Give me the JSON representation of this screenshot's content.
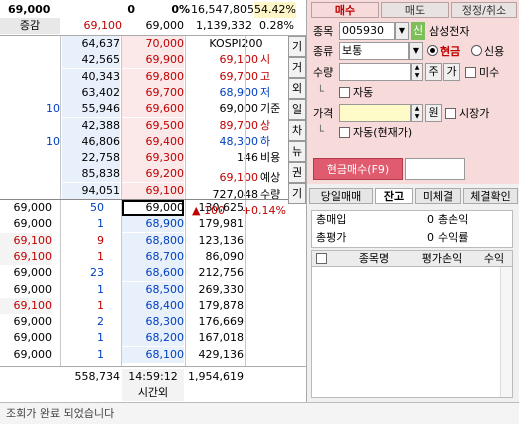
{
  "header": {
    "price": "69,000",
    "change": "0",
    "rate": "0%",
    "volume": "16,547,805",
    "vol_rate": "54.42%",
    "label": "증감",
    "prev_price": "69,100",
    "base_price": "69,000",
    "amount": "1,139,332",
    "amount_rate": "0.28%"
  },
  "orderbook": {
    "sell": [
      {
        "change": "",
        "qty": "64,637",
        "price": "70,000"
      },
      {
        "change": "",
        "qty": "42,565",
        "price": "69,900"
      },
      {
        "change": "",
        "qty": "40,343",
        "price": "69,800"
      },
      {
        "change": "",
        "qty": "63,402",
        "price": "69,700"
      },
      {
        "change": "10",
        "qty": "55,946",
        "price": "69,600"
      },
      {
        "change": "",
        "qty": "42,388",
        "price": "69,500"
      },
      {
        "change": "10",
        "qty": "46,806",
        "price": "69,400"
      },
      {
        "change": "",
        "qty": "22,758",
        "price": "69,300"
      },
      {
        "change": "",
        "qty": "85,838",
        "price": "69,200"
      },
      {
        "change": "",
        "qty": "94,051",
        "price": "69,100"
      }
    ],
    "buy": [
      {
        "price": "69,000",
        "qty": "130,625"
      },
      {
        "price": "68,900",
        "qty": "179,981"
      },
      {
        "price": "68,800",
        "qty": "123,136"
      },
      {
        "price": "68,700",
        "qty": "86,090"
      },
      {
        "price": "68,600",
        "qty": "212,756"
      },
      {
        "price": "68,500",
        "qty": "269,330"
      },
      {
        "price": "68,400",
        "qty": "179,878"
      },
      {
        "price": "68,300",
        "qty": "176,669"
      },
      {
        "price": "68,200",
        "qty": "167,018"
      },
      {
        "price": "68,100",
        "qty": "429,136"
      }
    ],
    "ticks": [
      {
        "price": "69,000",
        "qty": "50"
      },
      {
        "price": "69,000",
        "qty": "1"
      },
      {
        "price": "69,100",
        "qty": "9"
      },
      {
        "price": "69,100",
        "qty": "1"
      },
      {
        "price": "69,000",
        "qty": "23"
      },
      {
        "price": "69,000",
        "qty": "1"
      },
      {
        "price": "69,100",
        "qty": "1"
      },
      {
        "price": "69,000",
        "qty": "2"
      },
      {
        "price": "69,000",
        "qty": "1"
      },
      {
        "price": "69,000",
        "qty": "1"
      }
    ],
    "total_sell": "558,734",
    "time": "14:59:12",
    "time_label": "시간외",
    "total_buy": "1,954,619"
  },
  "info": {
    "index_name": "KOSPI200",
    "rows": [
      {
        "value": "69,100",
        "label": "시"
      },
      {
        "value": "69,700",
        "label": "고"
      },
      {
        "value": "68,900",
        "label": "저"
      },
      {
        "value": "69,000",
        "label": "기준"
      },
      {
        "value": "89,700",
        "label": "상"
      },
      {
        "value": "48,300",
        "label": "하"
      },
      {
        "value": "146",
        "label": "비용"
      }
    ],
    "expected_price": "69,100",
    "expected_label": "예상",
    "expected_qty": "727,048",
    "expected_qty_label": "수량",
    "expected_change": "▲ 100",
    "expected_rate": "+0.14%"
  },
  "side_buttons": [
    "기",
    "거",
    "외",
    "일",
    "차",
    "뉴",
    "권",
    "기"
  ],
  "order": {
    "tabs": [
      "매수",
      "매도",
      "정정/취소"
    ],
    "stock_label": "종목",
    "stock_code": "005930",
    "stock_tag": "신",
    "stock_name": "삼성전자",
    "type_label": "종류",
    "type_value": "보통",
    "cash_label": "현금",
    "credit_label": "신용",
    "qty_label": "수량",
    "qty_btn1": "주",
    "qty_btn2": "가",
    "miss_label": "미수",
    "auto_label": "자동",
    "price_label": "가격",
    "won_label": "원",
    "market_label": "시장가",
    "auto_cur_label": "자동(현재가)",
    "submit_label": "현금매수(F9)"
  },
  "balance": {
    "tabs": [
      "당일매매",
      "잔고",
      "미체결",
      "체결확인"
    ],
    "total_buy_label": "총매입",
    "total_buy_value": "0",
    "profit_label": "총손익",
    "total_eval_label": "총평가",
    "total_eval_value": "0",
    "yield_label": "수익률",
    "columns": [
      "종목명",
      "평가손익",
      "수익"
    ]
  },
  "status": {
    "message": "조회가 완료 되었습니다"
  },
  "colors": {
    "accent_red": "#c00000",
    "accent_blue": "#0040c0",
    "order_panel_bg": "#f7dada",
    "submit_bg": "#e05b6e"
  }
}
